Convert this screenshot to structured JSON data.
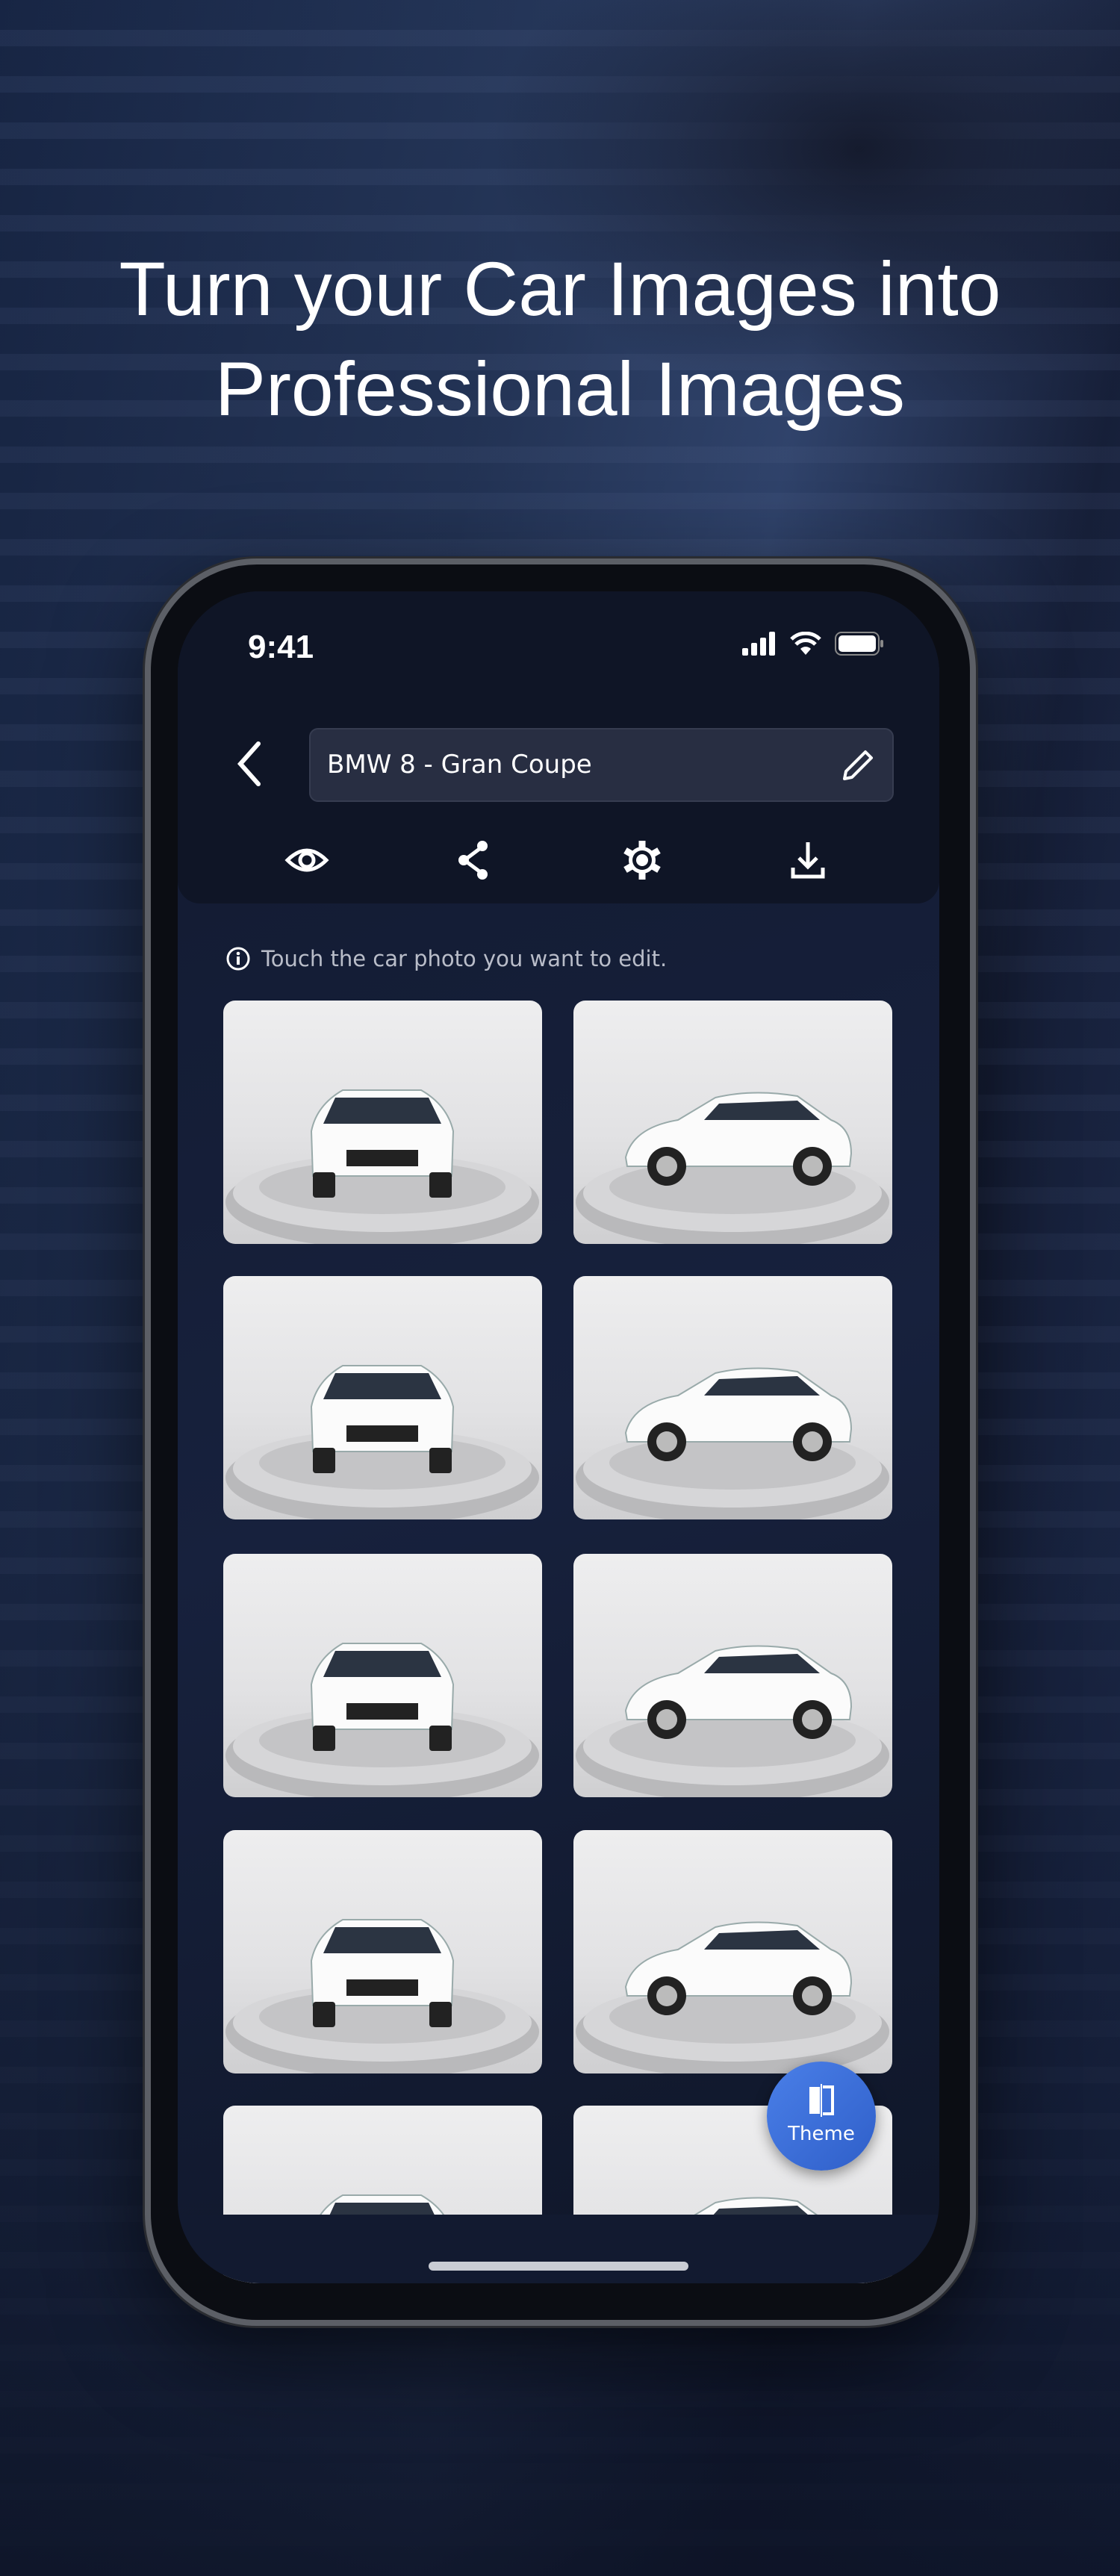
{
  "headline": {
    "line1": "Turn your Car Images into",
    "line2": "Professional Images"
  },
  "status_bar": {
    "time": "9:41",
    "icons": [
      "signal-icon",
      "wifi-icon",
      "battery-icon"
    ]
  },
  "header": {
    "back_icon": "chevron-left-icon",
    "project_name": "BMW 8 - Gran Coupe",
    "edit_icon": "pencil-icon",
    "actions": [
      {
        "icon": "eye-icon"
      },
      {
        "icon": "share-icon"
      },
      {
        "icon": "gear-icon"
      },
      {
        "icon": "download-icon"
      }
    ]
  },
  "info_text": "Touch the car photo you want to edit.",
  "theme_button": {
    "label": "Theme",
    "icon": "theme-icon",
    "color": "#3a6ddb"
  },
  "colors": {
    "screen_bg": "#141c34",
    "header_bg": "#0f1526",
    "field_bg": "#282e42"
  }
}
